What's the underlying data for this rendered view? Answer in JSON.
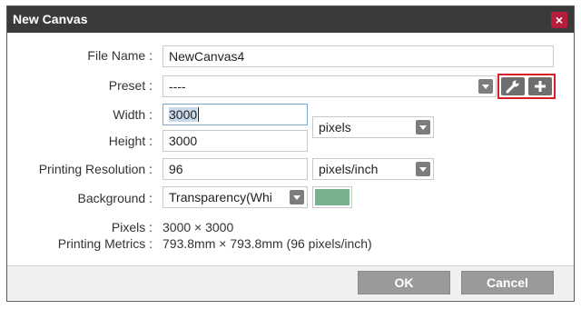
{
  "window": {
    "title": "New Canvas",
    "close_glyph": "×"
  },
  "form": {
    "file_name": {
      "label": "File Name :",
      "value": "NewCanvas4"
    },
    "preset": {
      "label": "Preset :",
      "value": "----",
      "tool_icon": "wrench-icon",
      "add_icon": "plus-icon"
    },
    "width": {
      "label": "Width :",
      "value": "3000"
    },
    "height": {
      "label": "Height :",
      "value": "3000"
    },
    "size_unit": {
      "value": "pixels"
    },
    "resolution": {
      "label": "Printing Resolution :",
      "value": "96",
      "unit": "pixels/inch"
    },
    "background": {
      "label": "Background :",
      "value": "Transparency(Whi",
      "color": "#77b28c"
    }
  },
  "info": {
    "pixels_label": "Pixels :",
    "pixels_value": "3000 × 3000",
    "metrics_label": "Printing Metrics :",
    "metrics_value": "793.8mm × 793.8mm (96 pixels/inch)"
  },
  "buttons": {
    "ok": "OK",
    "cancel": "Cancel"
  },
  "colors": {
    "titlebar": "#3a3a3a",
    "close": "#b71c3c",
    "highlight": "#d81e2a",
    "button": "#9a9a9a"
  }
}
